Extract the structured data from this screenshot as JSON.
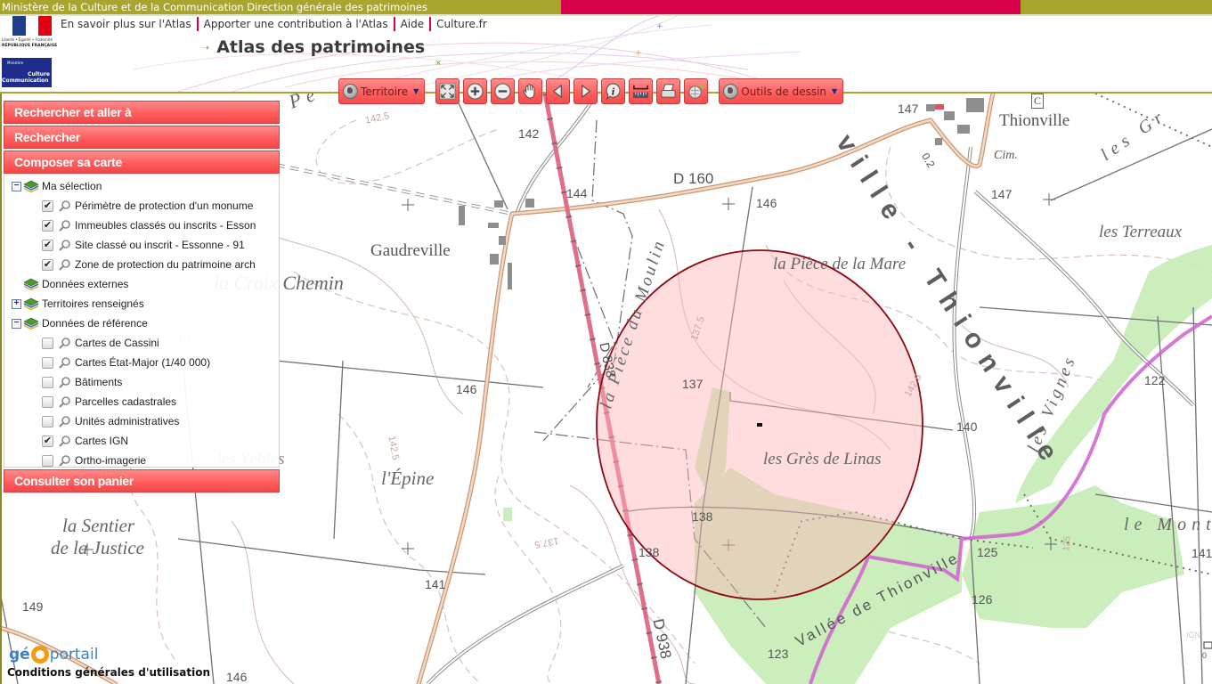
{
  "topbar": {
    "ministry_text": "Ministère de la Culture et de la Communication Direction générale des patrimoines",
    "colors": {
      "olive": "#a8a52e",
      "red": "#d9004a"
    }
  },
  "logos": {
    "republique_motto": "Liberté • Égalité • Fraternité",
    "republique_name": "RÉPUBLIQUE FRANÇAISE",
    "ministere_small": "Ministère",
    "ministere_culture": "Culture",
    "ministere_communication": "Communication"
  },
  "header": {
    "links": [
      {
        "label": "En savoir plus sur l'Atlas"
      },
      {
        "label": "Apporter une contribution à l'Atlas"
      },
      {
        "label": "Aide"
      },
      {
        "label": "Culture.fr"
      }
    ],
    "app_title": "Atlas des patrimoines",
    "title_icon": "arrow-right-icon"
  },
  "toolbar": {
    "territoire_label": "Territoire",
    "outils_label": "Outils de dessin",
    "buttons": [
      {
        "name": "full-extent",
        "icon": "full-extent-icon"
      },
      {
        "name": "zoom-in",
        "icon": "zoom-in-icon"
      },
      {
        "name": "zoom-out",
        "icon": "zoom-out-icon"
      },
      {
        "name": "pan",
        "icon": "hand-icon"
      },
      {
        "name": "previous-view",
        "icon": "arrow-left-icon"
      },
      {
        "name": "next-view",
        "icon": "arrow-right-icon"
      },
      {
        "name": "info",
        "icon": "info-icon"
      },
      {
        "name": "measure",
        "icon": "ruler-icon"
      },
      {
        "name": "print",
        "icon": "printer-icon"
      },
      {
        "name": "export",
        "icon": "map-export-icon"
      }
    ],
    "button_color": "#ff6666"
  },
  "sidebar": {
    "panels": {
      "search_goto": "Rechercher et aller à",
      "search": "Rechercher",
      "compose": "Composer sa carte",
      "basket": "Consulter son panier"
    },
    "tree": {
      "ma_selection": {
        "label": "Ma sélection",
        "expanded": true,
        "items": [
          {
            "label": "Périmètre de protection d'un monume",
            "checked": true
          },
          {
            "label": "Immeubles classés ou inscrits - Esson",
            "checked": true
          },
          {
            "label": "Site classé ou inscrit - Essonne - 91",
            "checked": true
          },
          {
            "label": "Zone de protection du patrimoine arch",
            "checked": true
          }
        ]
      },
      "donnees_externes": {
        "label": "Données externes"
      },
      "territoires": {
        "label": "Territoires renseignés",
        "expanded": false
      },
      "reference": {
        "label": "Données de référence",
        "expanded": true,
        "items": [
          {
            "label": "Cartes de Cassini",
            "checked": false
          },
          {
            "label": "Cartes État-Major (1/40 000)",
            "checked": false
          },
          {
            "label": "Bâtiments",
            "checked": false
          },
          {
            "label": "Parcelles cadastrales",
            "checked": false
          },
          {
            "label": "Unités administratives",
            "checked": false
          },
          {
            "label": "Cartes IGN",
            "checked": true
          },
          {
            "label": "Ortho-imagerie",
            "checked": false
          }
        ]
      }
    }
  },
  "map": {
    "place_names": {
      "gaudreville": "Gaudreville",
      "thionville": "Thionville",
      "cim": "Cim.",
      "la_croix_chemin": "la Croix Chemin",
      "la_piece_mare": "la Pièce de la Mare",
      "la_piece_moulin": "la Pièce du Moulin",
      "les_gres": "les Grès de Linas",
      "les_terreaux": "les Terreaux",
      "les_vignes": "les Vignes",
      "les_yebles": "les Yèbles",
      "l_epine": "l'Épine",
      "la_sentier": "la Sentier",
      "de_la_justice": "de la Justice",
      "le_mont": "le Mont",
      "vallee": "Vallée de Thionville",
      "valley_big": "ville - Thionville",
      "la_pe": "a Pe",
      "les_gr": "les Gr",
      "church_marker": "C"
    },
    "roads": {
      "d160": "D 160",
      "d838": "D 838",
      "d938": "D 938"
    },
    "elevations": [
      "142.5",
      "142",
      "144",
      "146",
      "147",
      "147",
      "146",
      "137",
      "137.5",
      "142.5",
      "140",
      "122",
      "138",
      "138",
      "141",
      "149",
      "146",
      "123",
      "125",
      "126",
      "137.5",
      "141",
      "0.2",
      "142.5",
      "148",
      "125"
    ],
    "scale_text": "IGN",
    "scale_zero": "0",
    "protection_circle_color": "#ffb3b8",
    "protection_circle_stroke": "#8b0a14"
  },
  "footer": {
    "geoportail_g": "g",
    "geoportail_e": "é",
    "geoportail_rest": "portail",
    "cgu": "Conditions générales d'utilisation"
  }
}
